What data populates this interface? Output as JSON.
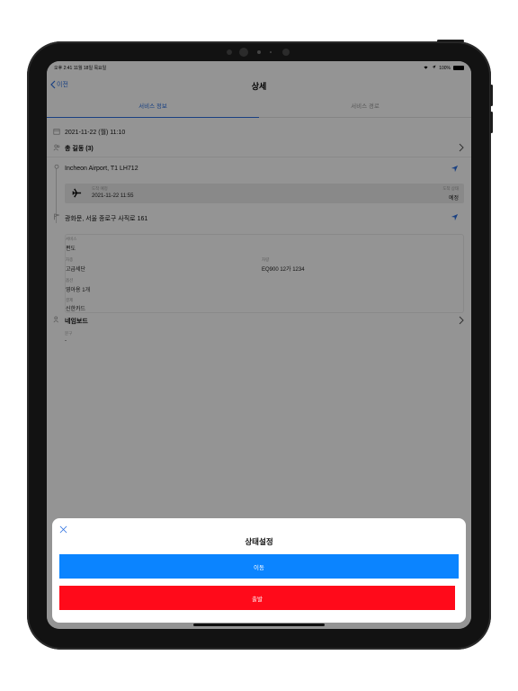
{
  "status_bar": {
    "time": "오후 2:41  11월 18일 목요일",
    "battery": "100%"
  },
  "nav": {
    "back_label": "이전",
    "title": "상세"
  },
  "tabs": [
    {
      "label": "서비스 정보",
      "active": true
    },
    {
      "label": "서비스 경로",
      "active": false
    }
  ],
  "service": {
    "datetime": "2021-11-22 (월) 11:10",
    "passengers": "총 길동 (3)",
    "pickup": "Incheon Airport, T1 LH712",
    "flight": {
      "arrival_label": "도착 예정",
      "arrival_time": "2021-11-22 11:55",
      "status_label": "도착 상태",
      "status": "예정"
    },
    "destination": "광화문, 서울 종로구 사직로 161"
  },
  "details": {
    "type_label": "서비스",
    "type_value": "편도",
    "vehicle_label": "차종",
    "vehicle_value": "고급세단",
    "car_label": "차량",
    "car_value": "EQ900 12가 1234",
    "option_label": "옵션",
    "option_value": "영아용 1개",
    "payment_label": "결제",
    "payment_value": "신한카드"
  },
  "nameboard": {
    "title": "네임보드",
    "label": "문구",
    "value": "-"
  },
  "sheet": {
    "title": "상태설정",
    "move_button": "이동",
    "depart_button": "출발"
  },
  "colors": {
    "accent": "#2b6fe0",
    "move_button": "#0b84ff",
    "depart_button": "#ff0a1a"
  }
}
